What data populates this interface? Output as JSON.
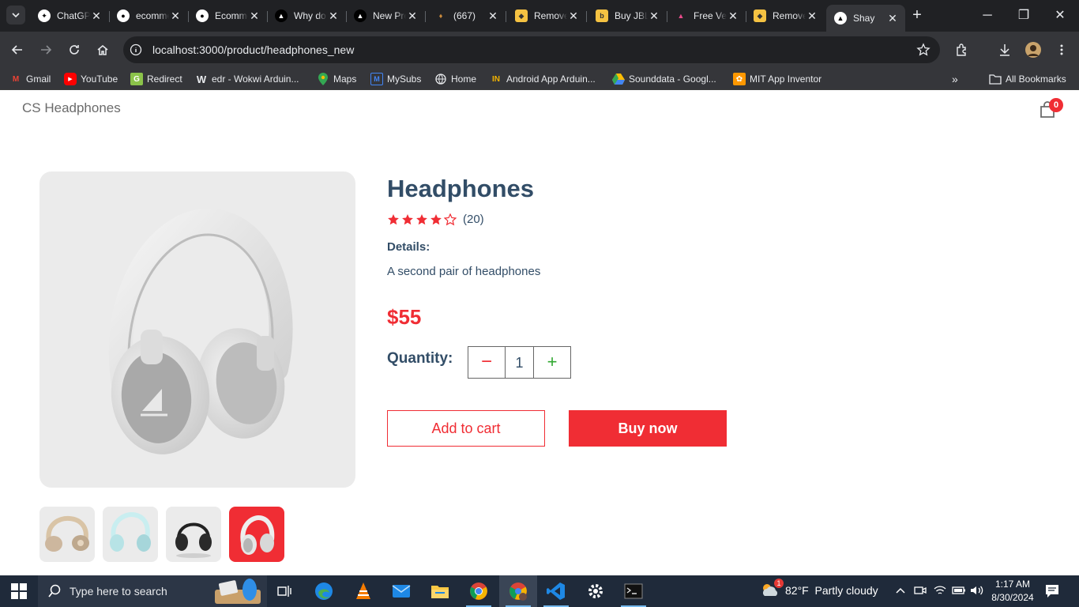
{
  "browser": {
    "tabs": [
      {
        "label": "ChatGPT",
        "icon": "openai-icon"
      },
      {
        "label": "ecommerce",
        "icon": "github-icon"
      },
      {
        "label": "Ecommerce",
        "icon": "github-icon"
      },
      {
        "label": "Why do",
        "icon": "vercel-icon"
      },
      {
        "label": "New Project",
        "icon": "vercel-icon"
      },
      {
        "label": "(667)",
        "icon": "gem-icon"
      },
      {
        "label": "Remove",
        "icon": "remove-bg-icon"
      },
      {
        "label": "Buy JBL",
        "icon": "shop-icon"
      },
      {
        "label": "Free Vector",
        "icon": "canva-icon"
      },
      {
        "label": "Remove",
        "icon": "remove-bg-icon"
      },
      {
        "label": "Shay",
        "icon": "vercel-icon"
      }
    ],
    "url": "localhost:3000/product/headphones_new",
    "bookmarks": [
      {
        "label": "Gmail",
        "icon": "gmail-icon",
        "color": "#ea4335"
      },
      {
        "label": "YouTube",
        "icon": "youtube-icon",
        "color": "#ff0000"
      },
      {
        "label": "Redirect",
        "icon": "redirect-icon",
        "color": "#8bc34a"
      },
      {
        "label": "edr - Wokwi Arduin...",
        "icon": "wokwi-icon",
        "color": "#e8eaed"
      },
      {
        "label": "Maps",
        "icon": "maps-icon",
        "color": "#34a853"
      },
      {
        "label": "MySubs",
        "icon": "mysubs-icon",
        "color": "#4285f4"
      },
      {
        "label": "Home",
        "icon": "globe-icon",
        "color": "#e8eaed"
      },
      {
        "label": "Android App Arduin...",
        "icon": "instructables-icon",
        "color": "#f4b400"
      },
      {
        "label": "Sounddata - Googl...",
        "icon": "drive-icon",
        "color": "#fbbc04"
      },
      {
        "label": "MIT App Inventor",
        "icon": "appinventor-icon",
        "color": "#ff9800"
      }
    ],
    "all_bookmarks": "All Bookmarks"
  },
  "site": {
    "logo": "CS Headphones",
    "cart_count": "0"
  },
  "product": {
    "name": "Headphones",
    "rating": 4,
    "rating_max": 5,
    "reviews": "(20)",
    "details_label": "Details:",
    "details": "A second pair of headphones",
    "price": "$55",
    "quantity_label": "Quantity:",
    "quantity": "1",
    "minus": "−",
    "plus": "+",
    "add_to_cart": "Add to cart",
    "buy_now": "Buy now",
    "thumbnails": [
      {
        "name": "beige-headphones",
        "color": "#cdb79e",
        "selected": false
      },
      {
        "name": "mint-headphones",
        "color": "#b7e3e6",
        "selected": false
      },
      {
        "name": "black-headphones",
        "color": "#2a2a2a",
        "selected": false
      },
      {
        "name": "white-headphones",
        "color": "#e6e6e6",
        "selected": true
      }
    ],
    "accent": "#f02d34",
    "text_color": "#324d67"
  },
  "taskbar": {
    "search_placeholder": "Type here to search",
    "weather": "82°F  Partly cloudy",
    "weather_badge": "1",
    "time": "1:17 AM",
    "date": "8/30/2024"
  }
}
